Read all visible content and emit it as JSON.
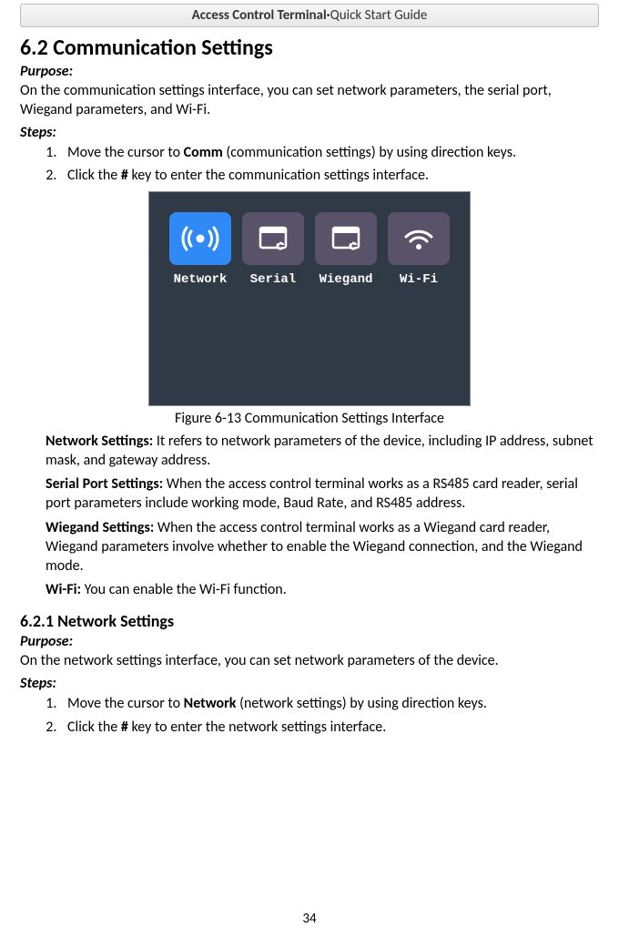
{
  "header": {
    "bold": "Access Control Terminal",
    "sep": "·",
    "light": "Quick Start Guide"
  },
  "section": {
    "number": "6.2",
    "title": "Communication Settings",
    "purpose_label": "Purpose:",
    "purpose_text": "On the communication settings interface, you can set network parameters, the serial port, Wiegand parameters, and Wi-Fi.",
    "steps_label": "Steps:",
    "steps": [
      {
        "pre": "Move the cursor to ",
        "bold": "Comm",
        "post": " (communication settings) by using direction keys."
      },
      {
        "pre": "Click the ",
        "bold": "#",
        "post": " key to enter the communication settings interface."
      }
    ]
  },
  "figure": {
    "tiles": [
      {
        "label": "Network",
        "selected": true
      },
      {
        "label": "Serial",
        "selected": false
      },
      {
        "label": "Wiegand",
        "selected": false
      },
      {
        "label": "Wi-Fi",
        "selected": false
      }
    ],
    "caption_prefix": "Figure 6-13",
    "caption_text": "Communication Settings Interface"
  },
  "definitions": [
    {
      "term": "Network Settings:",
      "text": " It refers to network parameters of the device, including IP address, subnet mask, and gateway address."
    },
    {
      "term": "Serial Port Settings:",
      "text": " When the access control terminal works as a RS485 card reader, serial port parameters include working mode, Baud Rate, and RS485 address."
    },
    {
      "term": "Wiegand Settings:",
      "text": " When the access control terminal works as a Wiegand card reader, Wiegand parameters involve whether to enable the Wiegand connection, and the Wiegand mode."
    },
    {
      "term": "Wi-Fi:",
      "text": " You can enable the Wi-Fi function."
    }
  ],
  "subsection": {
    "number": "6.2.1",
    "title": "Network Settings",
    "purpose_label": "Purpose:",
    "purpose_text": "On the network settings interface, you can set network parameters of the device.",
    "steps_label": "Steps:",
    "steps": [
      {
        "pre": "Move the cursor to ",
        "bold": "Network",
        "post": " (network settings) by using direction keys."
      },
      {
        "pre": "Click the ",
        "bold": "#",
        "post": " key to enter the network settings interface."
      }
    ]
  },
  "page_number": "34"
}
